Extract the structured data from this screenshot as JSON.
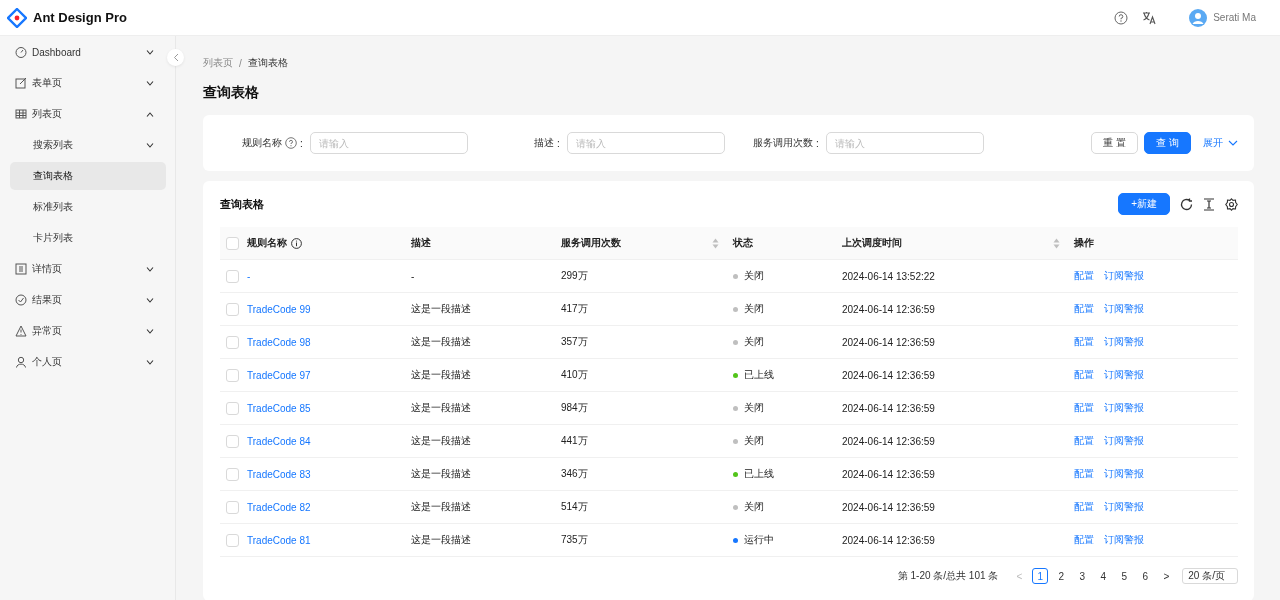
{
  "header": {
    "logo_text": "Ant Design Pro",
    "user": "Serati Ma"
  },
  "sidebar": {
    "items": [
      {
        "label": "Dashboard",
        "expanded": false,
        "selected": false
      },
      {
        "label": "表单页",
        "expanded": false,
        "selected": false
      },
      {
        "label": "列表页",
        "expanded": true,
        "selected": false,
        "children": [
          {
            "label": "搜索列表",
            "expanded": false,
            "selected": false
          },
          {
            "label": "查询表格",
            "selected": true
          },
          {
            "label": "标准列表",
            "selected": false
          },
          {
            "label": "卡片列表",
            "selected": false
          }
        ]
      },
      {
        "label": "详情页",
        "expanded": false,
        "selected": false
      },
      {
        "label": "结果页",
        "expanded": false,
        "selected": false
      },
      {
        "label": "异常页",
        "expanded": false,
        "selected": false
      },
      {
        "label": "个人页",
        "expanded": false,
        "selected": false
      }
    ]
  },
  "breadcrumb": [
    "列表页",
    "查询表格"
  ],
  "breadcrumb_separator": "/",
  "page_title": "查询表格",
  "search_form": {
    "fields": [
      {
        "label": "规则名称",
        "info": true,
        "colon": ":",
        "placeholder": "请输入"
      },
      {
        "label": "描述",
        "info": false,
        "colon": ":",
        "placeholder": "请输入"
      },
      {
        "label": "服务调用次数",
        "info": false,
        "colon": ":",
        "placeholder": "请输入"
      }
    ],
    "buttons": [
      {
        "label": "重 置",
        "kind": "default"
      },
      {
        "label": "查 询",
        "kind": "primary"
      }
    ],
    "expand_link": "展开"
  },
  "table_card": {
    "title": "查询表格",
    "new_button": "+新建",
    "select_all_checked": false,
    "columns": [
      {
        "label": "规则名称",
        "info": true,
        "sortable": false
      },
      {
        "label": "描述",
        "info": false,
        "sortable": false
      },
      {
        "label": "服务调用次数",
        "info": false,
        "sortable": true
      },
      {
        "label": "状态",
        "info": false,
        "sortable": false
      },
      {
        "label": "上次调度时间",
        "info": false,
        "sortable": true
      },
      {
        "label": "操作",
        "info": false,
        "sortable": false
      }
    ],
    "rows": [
      {
        "checked": false,
        "name": "-",
        "description": "-",
        "calls": "299万",
        "status": "关闭",
        "color": "#bfbfbf",
        "time": "2024-06-14 13:52:22",
        "actions": [
          "配置",
          "订阅警报"
        ]
      },
      {
        "checked": false,
        "name": "TradeCode 99",
        "description": "这是一段描述",
        "calls": "417万",
        "status": "关闭",
        "color": "#bfbfbf",
        "time": "2024-06-14 12:36:59",
        "actions": [
          "配置",
          "订阅警报"
        ]
      },
      {
        "checked": false,
        "name": "TradeCode 98",
        "description": "这是一段描述",
        "calls": "357万",
        "status": "关闭",
        "color": "#bfbfbf",
        "time": "2024-06-14 12:36:59",
        "actions": [
          "配置",
          "订阅警报"
        ]
      },
      {
        "checked": false,
        "name": "TradeCode 97",
        "description": "这是一段描述",
        "calls": "410万",
        "status": "已上线",
        "color": "#52c41a",
        "time": "2024-06-14 12:36:59",
        "actions": [
          "配置",
          "订阅警报"
        ]
      },
      {
        "checked": false,
        "name": "TradeCode 85",
        "description": "这是一段描述",
        "calls": "984万",
        "status": "关闭",
        "color": "#bfbfbf",
        "time": "2024-06-14 12:36:59",
        "actions": [
          "配置",
          "订阅警报"
        ]
      },
      {
        "checked": false,
        "name": "TradeCode 84",
        "description": "这是一段描述",
        "calls": "441万",
        "status": "关闭",
        "color": "#bfbfbf",
        "time": "2024-06-14 12:36:59",
        "actions": [
          "配置",
          "订阅警报"
        ]
      },
      {
        "checked": false,
        "name": "TradeCode 83",
        "description": "这是一段描述",
        "calls": "346万",
        "status": "已上线",
        "color": "#52c41a",
        "time": "2024-06-14 12:36:59",
        "actions": [
          "配置",
          "订阅警报"
        ]
      },
      {
        "checked": false,
        "name": "TradeCode 82",
        "description": "这是一段描述",
        "calls": "514万",
        "status": "关闭",
        "color": "#bfbfbf",
        "time": "2024-06-14 12:36:59",
        "actions": [
          "配置",
          "订阅警报"
        ]
      },
      {
        "checked": false,
        "name": "TradeCode 81",
        "description": "这是一段描述",
        "calls": "735万",
        "status": "运行中",
        "color": "#1677ff",
        "time": "2024-06-14 12:36:59",
        "actions": [
          "配置",
          "订阅警报"
        ]
      }
    ],
    "pagination": {
      "total_text": "第 1-20 条/总共 101 条",
      "pages": [
        {
          "label": "1",
          "selected": true
        },
        {
          "label": "2",
          "selected": false
        },
        {
          "label": "3",
          "selected": false
        },
        {
          "label": "4",
          "selected": false
        },
        {
          "label": "5",
          "selected": false
        },
        {
          "label": "6",
          "selected": false
        }
      ],
      "prev": "<",
      "next": ">",
      "page_size": "20 条/页"
    }
  }
}
